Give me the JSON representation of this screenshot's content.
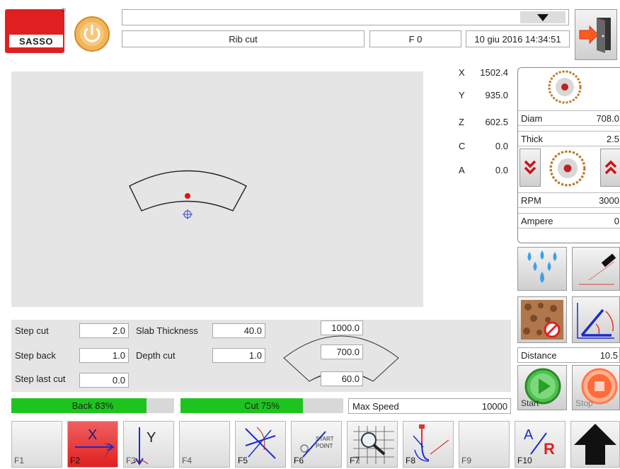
{
  "header": {
    "brand": "SASSO",
    "program_name": "Rib cut",
    "feed": "F 0",
    "datetime": "10 giu 2016 14:34:51",
    "top_field": ""
  },
  "axes": [
    {
      "name": "X",
      "value": "1502.4"
    },
    {
      "name": "Y",
      "value": "935.0"
    },
    {
      "name": "Z",
      "value": "602.5"
    },
    {
      "name": "C",
      "value": "0.0"
    },
    {
      "name": "A",
      "value": "0.0"
    }
  ],
  "blade": {
    "diam_label": "Diam",
    "diam_value": "708.0",
    "thick_label": "Thick",
    "thick_value": "2.5",
    "rpm_label": "RPM",
    "rpm_value": "3000",
    "ampere_label": "Ampere",
    "ampere_value": "0"
  },
  "distance": {
    "label": "Distance",
    "value": "10.5"
  },
  "params": {
    "step_cut_label": "Step cut",
    "step_cut_value": "2.0",
    "step_back_label": "Step back",
    "step_back_value": "1.0",
    "step_last_label": "Step last cut",
    "step_last_value": "0.0",
    "slab_label": "Slab Thickness",
    "slab_value": "40.0",
    "depth_label": "Depth cut",
    "depth_value": "1.0"
  },
  "arc_dims": {
    "outer": "1000.0",
    "inner": "700.0",
    "height": "60.0"
  },
  "progress": {
    "back_label": "Back 83%",
    "back_fraction": 0.83,
    "cut_label": "Cut 75%",
    "cut_fraction": 0.75,
    "max_speed_label": "Max Speed",
    "max_speed_value": "10000"
  },
  "controls": {
    "start_label": "Start",
    "stop_label": "Stop"
  },
  "fkeys": [
    "F1",
    "F2",
    "F3",
    "F4",
    "F5",
    "F6",
    "F7",
    "F8",
    "F9",
    "F10"
  ],
  "fkey_glyphs": {
    "f2": "X",
    "f3": "Y",
    "f6_top": "START",
    "f6_bottom": "POINT",
    "f10_a": "A",
    "f10_r": "R"
  },
  "colors": {
    "brand_red": "#e02020",
    "accent_green": "#1ec41e",
    "stop_orange": "#ff6a3a",
    "preview_bg": "#e5e5e5"
  }
}
